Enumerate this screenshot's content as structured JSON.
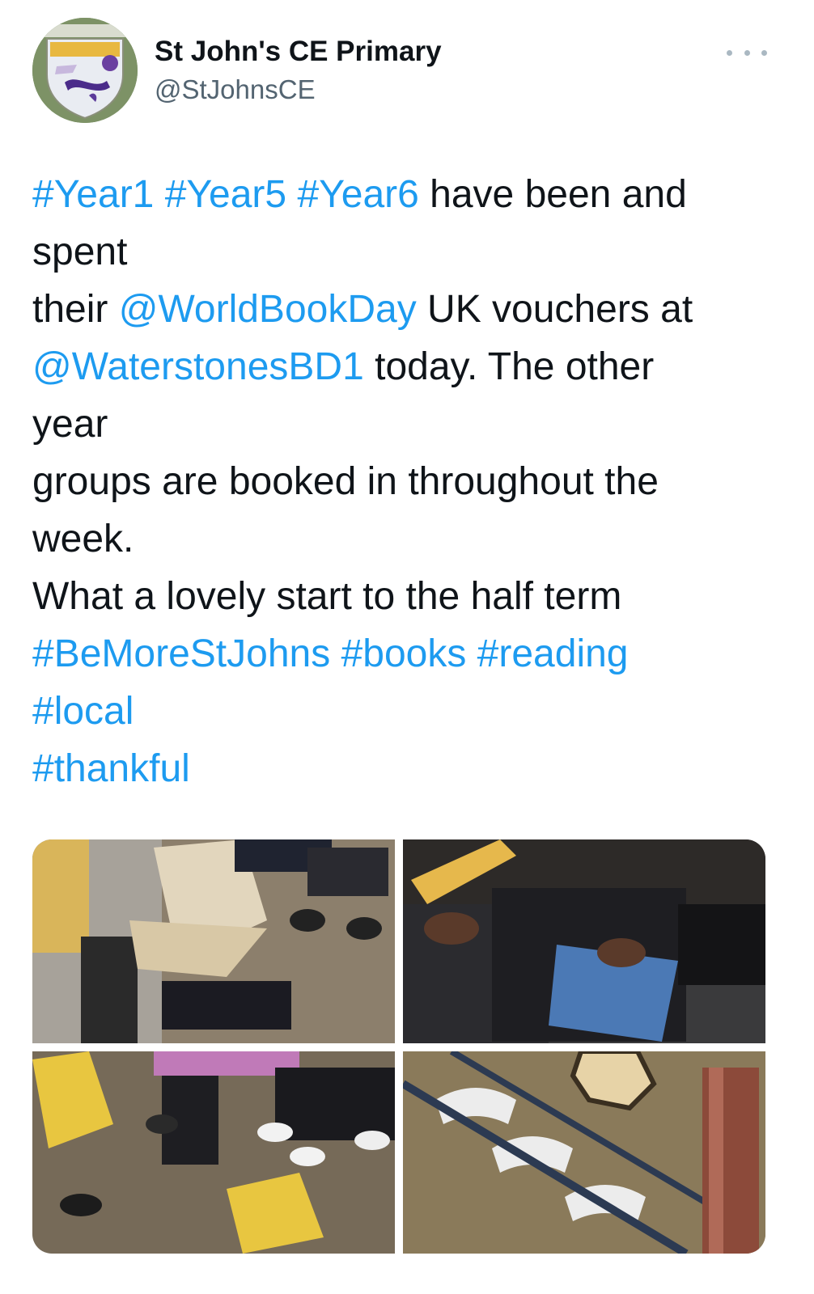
{
  "author": {
    "name": "St John's CE Primary",
    "handle": "@StJohnsCE",
    "avatar_icon": "school-badge-avatar"
  },
  "more_icon": "more-options-icon",
  "tweet": {
    "lines": [
      [
        {
          "text": "#Year1",
          "link": true
        },
        {
          "text": " ",
          "link": false
        },
        {
          "text": "#Year5",
          "link": true
        },
        {
          "text": " ",
          "link": false
        },
        {
          "text": "#Year6",
          "link": true
        },
        {
          "text": " have been and",
          "link": false
        }
      ],
      [
        {
          "text": "spent",
          "link": false
        }
      ],
      [
        {
          "text": "their ",
          "link": false
        },
        {
          "text": "@WorldBookDay",
          "link": true
        },
        {
          "text": " UK vouchers at",
          "link": false
        }
      ],
      [
        {
          "text": "@WaterstonesBD1",
          "link": true
        },
        {
          "text": " today. The other",
          "link": false
        }
      ],
      [
        {
          "text": "year",
          "link": false
        }
      ],
      [
        {
          "text": "groups are booked in throughout the",
          "link": false
        }
      ],
      [
        {
          "text": "week.",
          "link": false
        }
      ],
      [
        {
          "text": "What a lovely start to the half term",
          "link": false
        }
      ],
      [
        {
          "text": "#BeMoreStJohns",
          "link": true
        },
        {
          "text": " ",
          "link": false
        },
        {
          "text": "#books",
          "link": true
        },
        {
          "text": " ",
          "link": false
        },
        {
          "text": "#reading",
          "link": true
        }
      ],
      [
        {
          "text": "#local",
          "link": true
        }
      ],
      [
        {
          "text": "#thankful",
          "link": true
        }
      ]
    ]
  },
  "colors": {
    "link": "#1d9bf0",
    "text": "#0f1419",
    "secondary": "#536471"
  },
  "media": [
    {
      "id": "photo-1",
      "subject": "children holding open picture book on carpet"
    },
    {
      "id": "photo-2",
      "subject": "children holding books while seated"
    },
    {
      "id": "photo-3",
      "subject": "children's feet and books on carpet"
    },
    {
      "id": "photo-4",
      "subject": "ornate arched roof of bookshop building"
    }
  ]
}
